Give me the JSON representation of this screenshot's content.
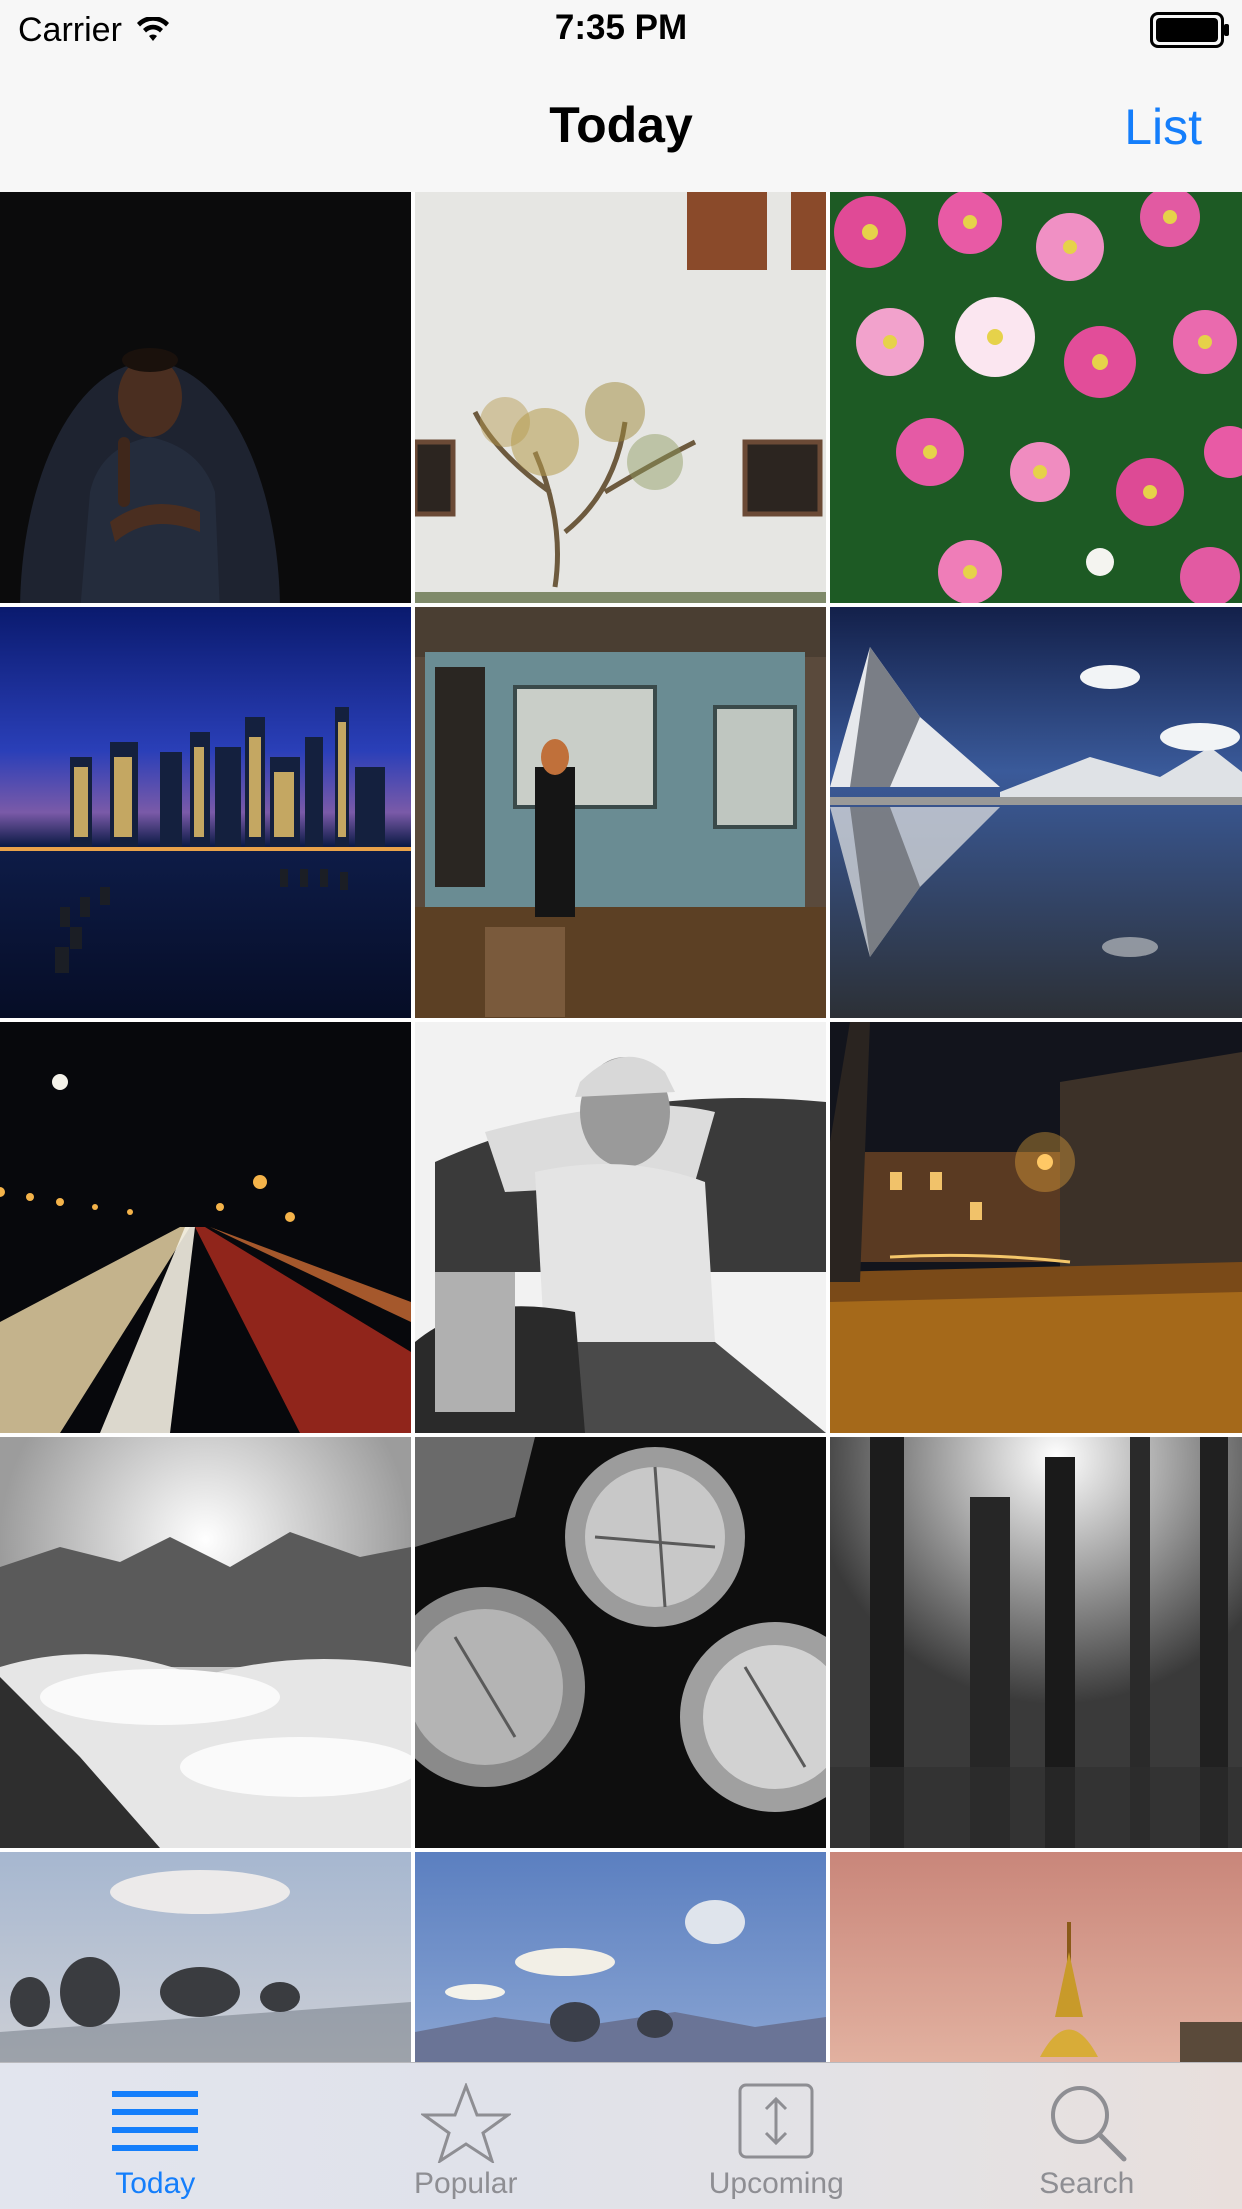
{
  "status": {
    "carrier": "Carrier",
    "time": "7:35 PM",
    "battery_level": 1.0
  },
  "nav": {
    "title": "Today",
    "right_button": "List"
  },
  "photos": [
    {
      "subject": "man-portrait-dark"
    },
    {
      "subject": "vine-on-white-wall"
    },
    {
      "subject": "pink-flowers"
    },
    {
      "subject": "city-skyline-night"
    },
    {
      "subject": "woman-by-shed"
    },
    {
      "subject": "mountain-reflection"
    },
    {
      "subject": "highway-light-trails"
    },
    {
      "subject": "old-man-smoking"
    },
    {
      "subject": "village-street-night"
    },
    {
      "subject": "mountains-above-clouds"
    },
    {
      "subject": "stacked-logs"
    },
    {
      "subject": "forest-bw"
    },
    {
      "subject": "trees-misty-lake"
    },
    {
      "subject": "blue-sky-clouds"
    },
    {
      "subject": "golden-pagoda-dusk"
    }
  ],
  "tabs": [
    {
      "label": "Today",
      "icon": "list-icon",
      "active": true
    },
    {
      "label": "Popular",
      "icon": "star-icon",
      "active": false
    },
    {
      "label": "Upcoming",
      "icon": "upcoming-icon",
      "active": false
    },
    {
      "label": "Search",
      "icon": "search-icon",
      "active": false
    }
  ],
  "colors": {
    "accent": "#147efb",
    "inactive": "#8e8e93"
  }
}
